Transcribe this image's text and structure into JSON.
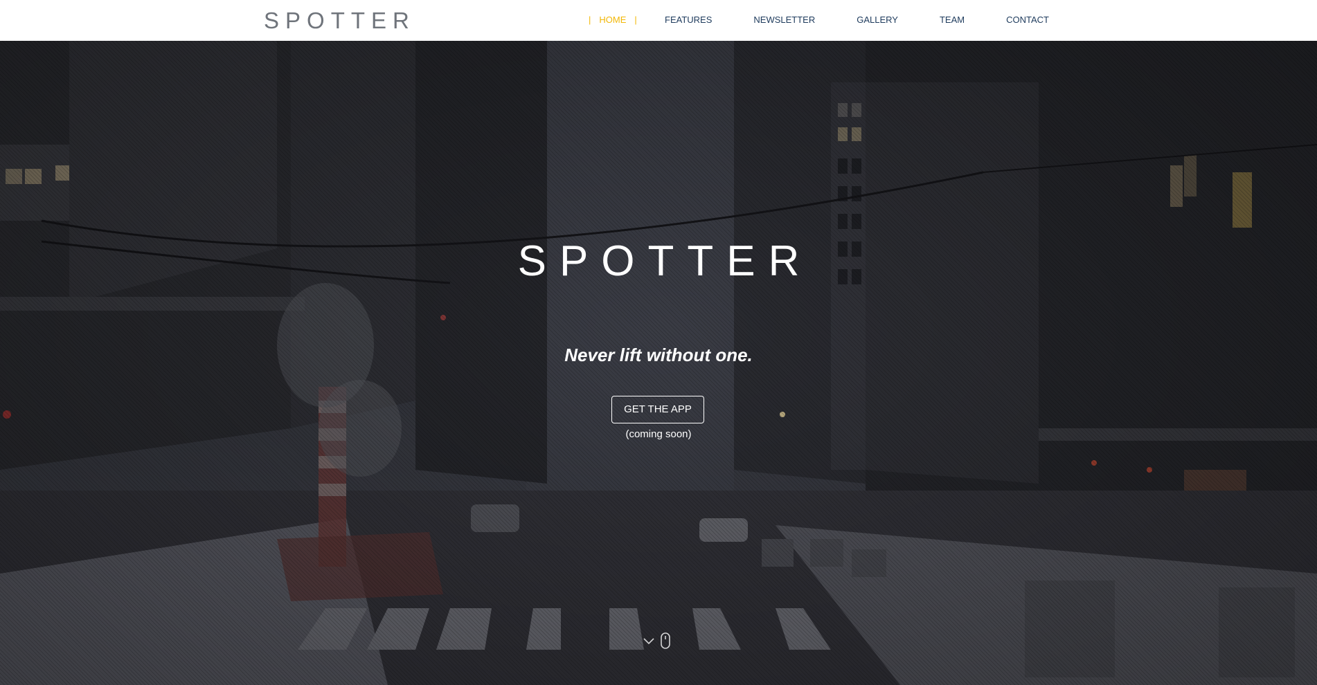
{
  "header": {
    "brand": "SPOTTER",
    "nav": {
      "home": "HOME",
      "features": "FEATURES",
      "newsletter": "NEWSLETTER",
      "gallery": "GALLERY",
      "team": "TEAM",
      "contact": "CONTACT",
      "active_separator": "|"
    }
  },
  "hero": {
    "title": "SPOTTER",
    "tagline": "Never lift without one.",
    "cta_label": "GET THE APP",
    "cta_note": "(coming soon)",
    "scroll_icon": "mouse-scroll-icon"
  },
  "colors": {
    "nav_text": "#1d3a5c",
    "nav_active": "#f2b705",
    "brand_text": "#6f747b",
    "hero_text": "#ffffff"
  }
}
